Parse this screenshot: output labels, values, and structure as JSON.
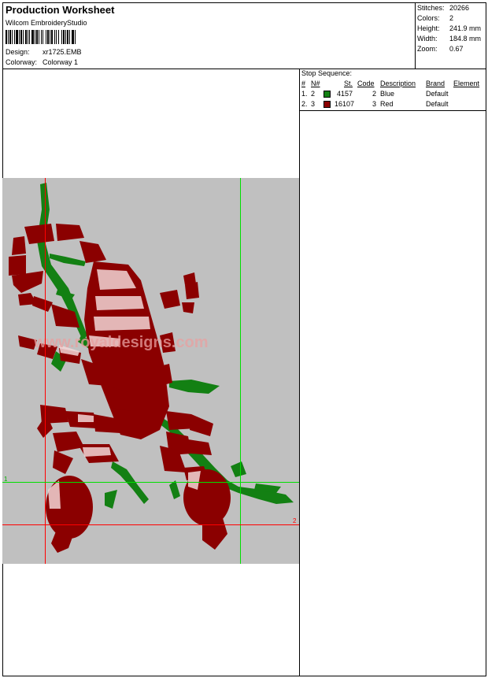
{
  "header": {
    "title": "Production Worksheet",
    "software": "Wilcom EmbroideryStudio",
    "design_label": "Design:",
    "design_value": "xr1725.EMB",
    "colorway_label": "Colorway:",
    "colorway_value": "Colorway 1"
  },
  "stats": [
    {
      "label": "Stitches:",
      "value": "20266"
    },
    {
      "label": "Colors:",
      "value": "2"
    },
    {
      "label": "Height:",
      "value": "241.9 mm"
    },
    {
      "label": "Width:",
      "value": "184.8 mm"
    },
    {
      "label": "Zoom:",
      "value": "0.67"
    }
  ],
  "stop_sequence": {
    "title": "Stop Sequence:",
    "headers": [
      "#",
      "N#",
      "St.",
      "Code",
      "Description",
      "Brand",
      "Element"
    ],
    "rows": [
      {
        "num": "1.",
        "needle": "2",
        "color": "#138013",
        "stitches": "4157",
        "code": "2",
        "description": "Blue",
        "brand": "Default"
      },
      {
        "num": "2.",
        "needle": "3",
        "color": "#8b0000",
        "stitches": "16107",
        "code": "3",
        "description": "Red",
        "brand": "Default"
      }
    ]
  },
  "design": {
    "watermark": "www.royaldesigns.com",
    "marker_1": "1",
    "marker_2": "2",
    "background_color": "#c0c0c0",
    "guide_red": "#ff0000",
    "guide_green": "#00e000"
  }
}
